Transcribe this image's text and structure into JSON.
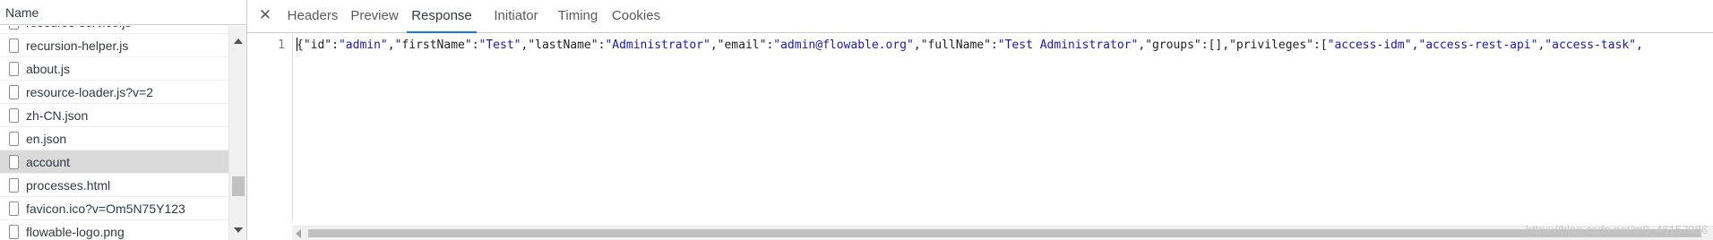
{
  "requests": {
    "column_header": "Name",
    "items": [
      {
        "name": "resource-service.js",
        "selected": false
      },
      {
        "name": "recursion-helper.js",
        "selected": false
      },
      {
        "name": "about.js",
        "selected": false
      },
      {
        "name": "resource-loader.js?v=2",
        "selected": false
      },
      {
        "name": "zh-CN.json",
        "selected": false
      },
      {
        "name": "en.json",
        "selected": false
      },
      {
        "name": "account",
        "selected": true
      },
      {
        "name": "processes.html",
        "selected": false
      },
      {
        "name": "favicon.ico?v=Om5N75Y123",
        "selected": false
      },
      {
        "name": "flowable-logo.png",
        "selected": false
      }
    ]
  },
  "detail": {
    "close_icon": "close-icon",
    "tabs": [
      {
        "label": "Headers",
        "active": false
      },
      {
        "label": "Preview",
        "active": false
      },
      {
        "label": "Response",
        "active": true
      },
      {
        "label": "Initiator",
        "active": false
      },
      {
        "label": "Timing",
        "active": false
      },
      {
        "label": "Cookies",
        "active": false
      }
    ],
    "response": {
      "line_number": "1",
      "tokens": [
        {
          "t": "{",
          "c": "p"
        },
        {
          "t": "\"id\"",
          "c": "p"
        },
        {
          "t": ":",
          "c": "p"
        },
        {
          "t": "\"admin\"",
          "c": "s"
        },
        {
          "t": ",",
          "c": "p"
        },
        {
          "t": "\"firstName\"",
          "c": "p"
        },
        {
          "t": ":",
          "c": "p"
        },
        {
          "t": "\"Test\"",
          "c": "s"
        },
        {
          "t": ",",
          "c": "p"
        },
        {
          "t": "\"lastName\"",
          "c": "p"
        },
        {
          "t": ":",
          "c": "p"
        },
        {
          "t": "\"Administrator\"",
          "c": "s"
        },
        {
          "t": ",",
          "c": "p"
        },
        {
          "t": "\"email\"",
          "c": "p"
        },
        {
          "t": ":",
          "c": "p"
        },
        {
          "t": "\"admin@flowable.org\"",
          "c": "s"
        },
        {
          "t": ",",
          "c": "p"
        },
        {
          "t": "\"fullName\"",
          "c": "p"
        },
        {
          "t": ":",
          "c": "p"
        },
        {
          "t": "\"Test Administrator\"",
          "c": "s"
        },
        {
          "t": ",",
          "c": "p"
        },
        {
          "t": "\"groups\"",
          "c": "p"
        },
        {
          "t": ":[],",
          "c": "p"
        },
        {
          "t": "\"privileges\"",
          "c": "p"
        },
        {
          "t": ":[",
          "c": "p"
        },
        {
          "t": "\"access-idm\"",
          "c": "s"
        },
        {
          "t": ",",
          "c": "p"
        },
        {
          "t": "\"access-rest-api\"",
          "c": "s"
        },
        {
          "t": ",",
          "c": "p"
        },
        {
          "t": "\"access-task\"",
          "c": "s"
        },
        {
          "t": ",",
          "c": "p"
        }
      ]
    }
  },
  "watermark": "https://blog.csdn.net/m0_46157986",
  "colors": {
    "accent": "#1a73e8",
    "json_string": "#1a1aa6",
    "selected_row": "#dadada"
  }
}
